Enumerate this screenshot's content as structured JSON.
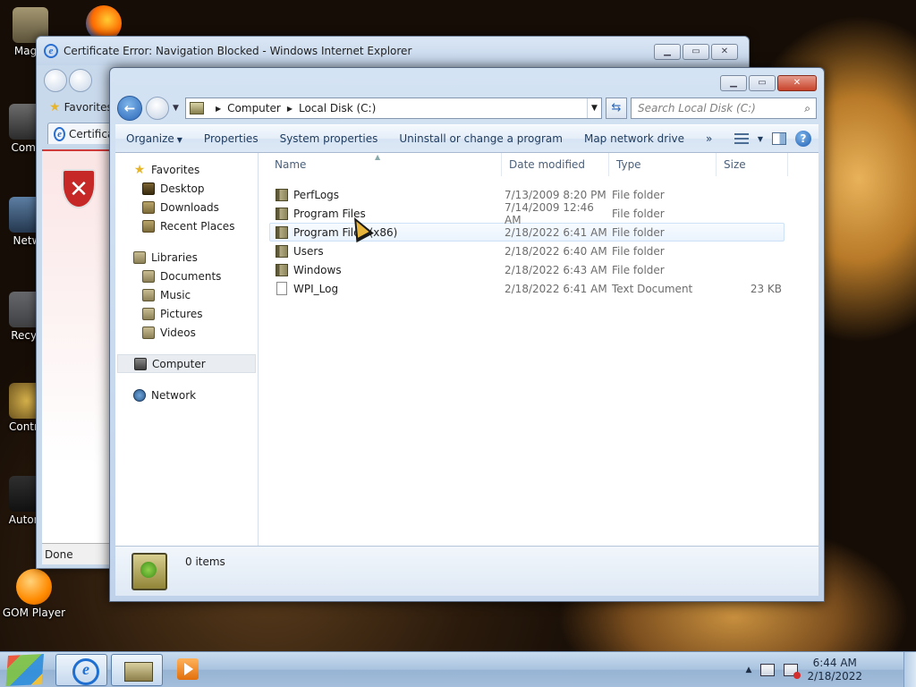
{
  "desktop": {
    "icons": [
      {
        "label": "Magpi",
        "icon": "magpie-icon"
      },
      {
        "label": "Comp",
        "icon": "computer-icon"
      },
      {
        "label": "Netw",
        "icon": "network-icon"
      },
      {
        "label": "Recyc",
        "icon": "recycle-bin-icon"
      },
      {
        "label": "Contro",
        "icon": "control-panel-icon"
      },
      {
        "label": "Autoru",
        "icon": "autorun-icon"
      },
      {
        "label": "GOM Player",
        "icon": "gom-player-icon"
      }
    ]
  },
  "ie_window": {
    "title": "Certificate Error: Navigation Blocked - Windows Internet Explorer",
    "favorites_label": "Favorites",
    "tab_label": "Certificat",
    "status_text": "Done"
  },
  "explorer": {
    "breadcrumb": [
      "Computer",
      "Local Disk (C:)"
    ],
    "search_placeholder": "Search Local Disk (C:)",
    "toolbar": {
      "organize": "Organize",
      "properties": "Properties",
      "system_properties": "System properties",
      "uninstall": "Uninstall or change a program",
      "map_drive": "Map network drive",
      "more": "»"
    },
    "nav": {
      "favorites": "Favorites",
      "desktop": "Desktop",
      "downloads": "Downloads",
      "recent": "Recent Places",
      "libraries": "Libraries",
      "documents": "Documents",
      "music": "Music",
      "pictures": "Pictures",
      "videos": "Videos",
      "computer": "Computer",
      "network": "Network"
    },
    "columns": {
      "name": "Name",
      "date": "Date modified",
      "type": "Type",
      "size": "Size"
    },
    "files": [
      {
        "name": "PerfLogs",
        "date": "7/13/2009 8:20 PM",
        "type": "File folder",
        "size": ""
      },
      {
        "name": "Program Files",
        "date": "7/14/2009 12:46 AM",
        "type": "File folder",
        "size": ""
      },
      {
        "name": "Program Files (x86)",
        "date": "2/18/2022 6:41 AM",
        "type": "File folder",
        "size": ""
      },
      {
        "name": "Users",
        "date": "2/18/2022 6:40 AM",
        "type": "File folder",
        "size": ""
      },
      {
        "name": "Windows",
        "date": "2/18/2022 6:43 AM",
        "type": "File folder",
        "size": ""
      },
      {
        "name": "WPI_Log",
        "date": "2/18/2022 6:41 AM",
        "type": "Text Document",
        "size": "23 KB"
      }
    ],
    "details": {
      "item_count": "0 items"
    }
  },
  "taskbar": {
    "time": "6:44 AM",
    "date": "2/18/2022"
  }
}
